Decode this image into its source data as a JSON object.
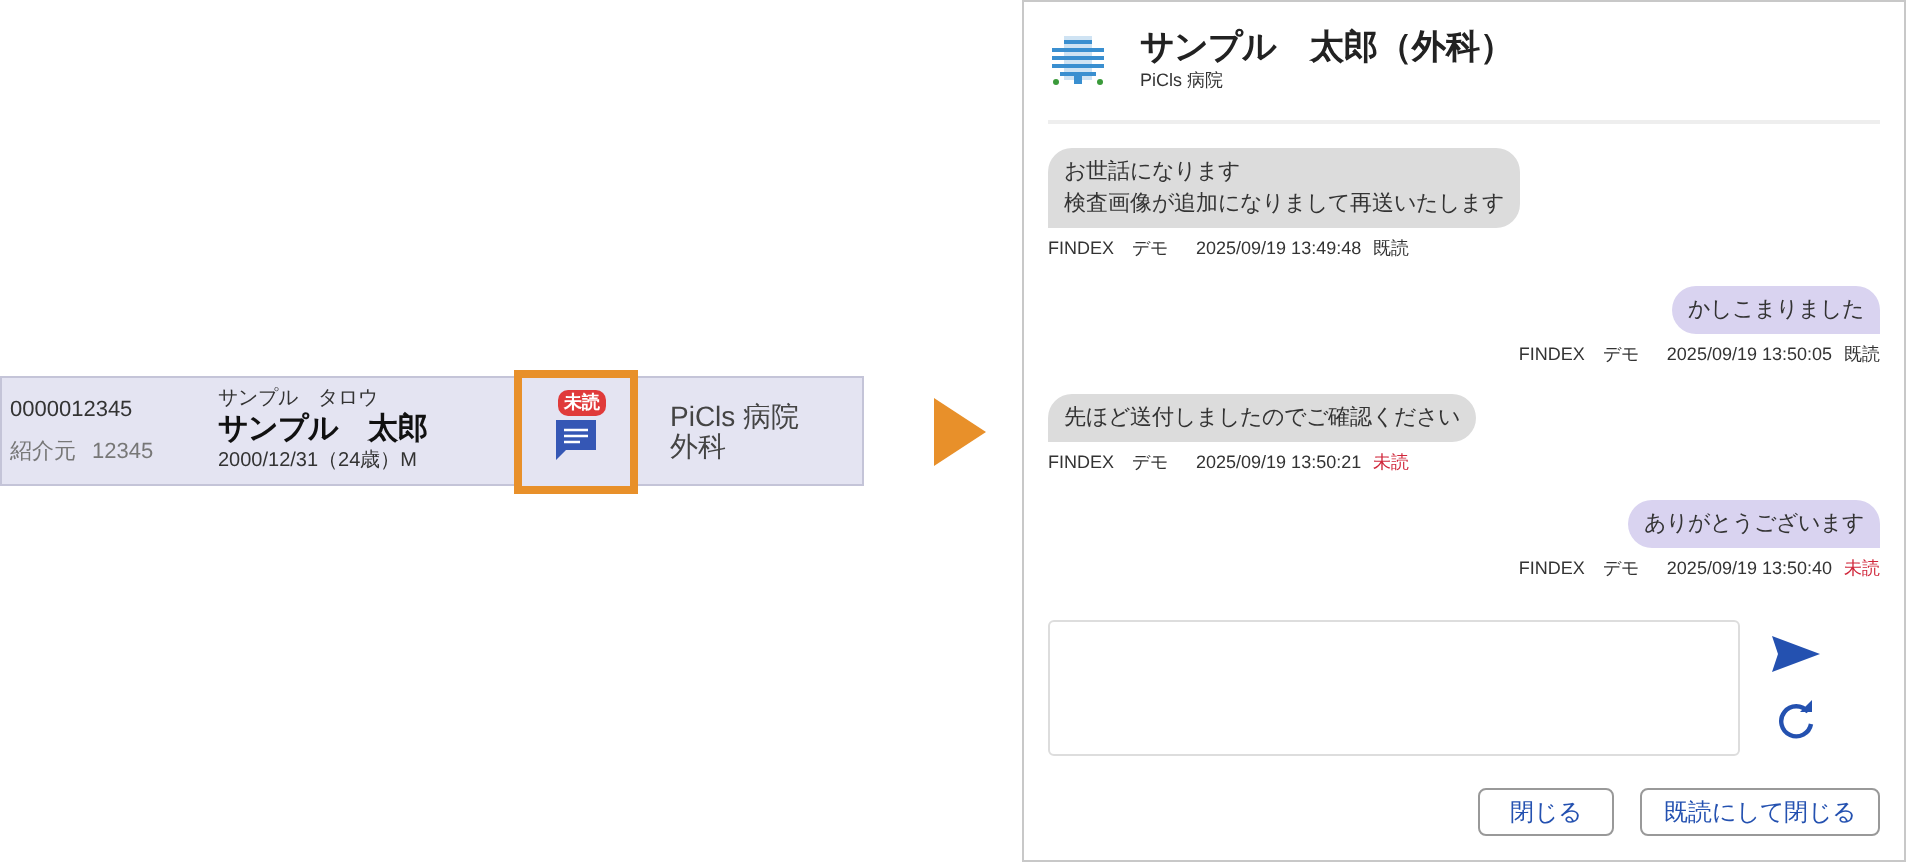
{
  "patient_row": {
    "patient_id": "0000012345",
    "referral_label": "紹介元",
    "referral_code": "12345",
    "name_kana": "サンプル　タロウ",
    "name": "サンプル　太郎",
    "birth_info": "2000/12/31（24歳）M",
    "unread_badge": "未読",
    "hospital": "PiCls 病院",
    "department": "外科"
  },
  "dialog": {
    "title": "サンプル　太郎（外科）",
    "subtitle": "PiCls 病院",
    "messages": [
      {
        "outgoing": false,
        "lines": [
          "お世話になります",
          "検査画像が追加になりまして再送いたします"
        ],
        "sender": "FINDEX　デモ",
        "time": "2025/09/19 13:49:48",
        "status": "既読",
        "read": true
      },
      {
        "outgoing": true,
        "lines": [
          "かしこまりました"
        ],
        "sender": "FINDEX　デモ",
        "time": "2025/09/19 13:50:05",
        "status": "既読",
        "read": true
      },
      {
        "outgoing": false,
        "lines": [
          "先ほど送付しましたのでご確認ください"
        ],
        "sender": "FINDEX　デモ",
        "time": "2025/09/19 13:50:21",
        "status": "未読",
        "read": false
      },
      {
        "outgoing": true,
        "lines": [
          "ありがとうございます"
        ],
        "sender": "FINDEX　デモ",
        "time": "2025/09/19 13:50:40",
        "status": "未読",
        "read": false
      }
    ],
    "buttons": [
      "閉じる",
      "既読にして閉じる"
    ]
  }
}
